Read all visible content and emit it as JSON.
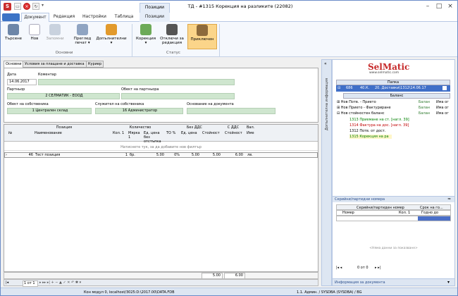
{
  "window": {
    "title": "ТД - #1315 Корекция на разликите (22082)",
    "context_tab": "Позиции"
  },
  "ribbon_tabs": [
    "Документ",
    "Редакция",
    "Настройки",
    "Таблица",
    "Позиции"
  ],
  "ribbon": {
    "buttons": [
      {
        "label": "Търсене"
      },
      {
        "label": "Нов"
      },
      {
        "label": "Запомни"
      },
      {
        "label": "Преглед печат"
      },
      {
        "label": "Допълнителни"
      },
      {
        "label": "Корекция"
      },
      {
        "label": "Отключи за редакция"
      },
      {
        "label": "Приключен"
      }
    ],
    "groups": [
      "Основни",
      "Статус"
    ]
  },
  "doc_tabs": [
    "Основни",
    "Условия за плащане и доставка",
    "Куриер"
  ],
  "form": {
    "date_label": "Дата",
    "date_value": "14.06.2017",
    "comment_label": "Коментар",
    "partner_label": "Партньор",
    "partner_value": "2 СЕЛМАТИК - ЕООД",
    "partner_object_label": "Обект на партньора",
    "own_object_label": "Обект на собственика",
    "own_object_value": "1 Централен склад",
    "own_employee_label": "Служител на собственика",
    "own_employee_value": "16 Администратор",
    "doc_basis_label": "Основание на документа"
  },
  "grid": {
    "group_headers": [
      "Позиция",
      "Количество",
      "Без ДДС",
      "С ДДС",
      "Вал."
    ],
    "columns": [
      "№",
      "Наименование",
      "Кол. 1",
      "Мярка 1",
      "Ед. цена без отстъпка",
      "ТО %",
      "Ед. цена",
      "Стойност",
      "Стойност",
      "Име"
    ],
    "filter_hint": "Натиснете тук, за да добавите нов филтър",
    "rows": [
      {
        "no": "46",
        "name": "Тест позиция",
        "qty": "1",
        "unit": "бр.",
        "price_nodisc": "5.00",
        "discount": "0%",
        "price": "5.00",
        "value": "5.00",
        "value_vat": "6.00",
        "currency": "лв."
      }
    ],
    "total_novat": "5.00",
    "total_vat": "6.00",
    "nav_text": "1 от 1"
  },
  "side_panel": {
    "left_label": "Допълнителна информация",
    "logo_main": "SelMatic",
    "logo_sub": "www.selmatic.com",
    "folder_header": "Папка",
    "folder_row": {
      "id": "686",
      "code": "40.К.",
      "title": "20. Доставки\\1312\\14.06.17"
    },
    "balance_header": "Баланс",
    "tree": [
      {
        "label": "Нов Потв. - Прието",
        "status": "Балан",
        "status2": "Има ог"
      },
      {
        "label": "Нов Прието - Фактуриране",
        "status": "Балан",
        "status2": "Има ог"
      },
      {
        "label": "Нов стойностен баланс",
        "status": "Балан",
        "status2": "Има ог"
      }
    ],
    "links": [
      {
        "text": "1313 Приемане на ст. [нагл. 39]",
        "color": "#008000"
      },
      {
        "text": "1314 Фактура на дос. [нагл. 39]",
        "color": "#c00000"
      },
      {
        "text": "1312 Потв. от дост.",
        "color": "#000000"
      },
      {
        "text": "1315 Корекция на ра",
        "color": "#008000"
      }
    ],
    "serial_title": "Серийни/партидни номера",
    "serial_columns": [
      "Серийни/партиден номер",
      "Срок на го..."
    ],
    "serial_row": {
      "c1": "Номер",
      "c2": "Кол. 1",
      "c3": "Годно до"
    },
    "serial_empty": "<Няма данни за показване>",
    "serial_nav": "0 от 0",
    "doc_info_title": "Информация за документа"
  },
  "status": {
    "left": "Кон модул 0, localhost/3025:D:\\2017.00\\DATA.FDB",
    "right": "1.1. Админ. / SYSDBA (SYSDBA) / BG"
  }
}
